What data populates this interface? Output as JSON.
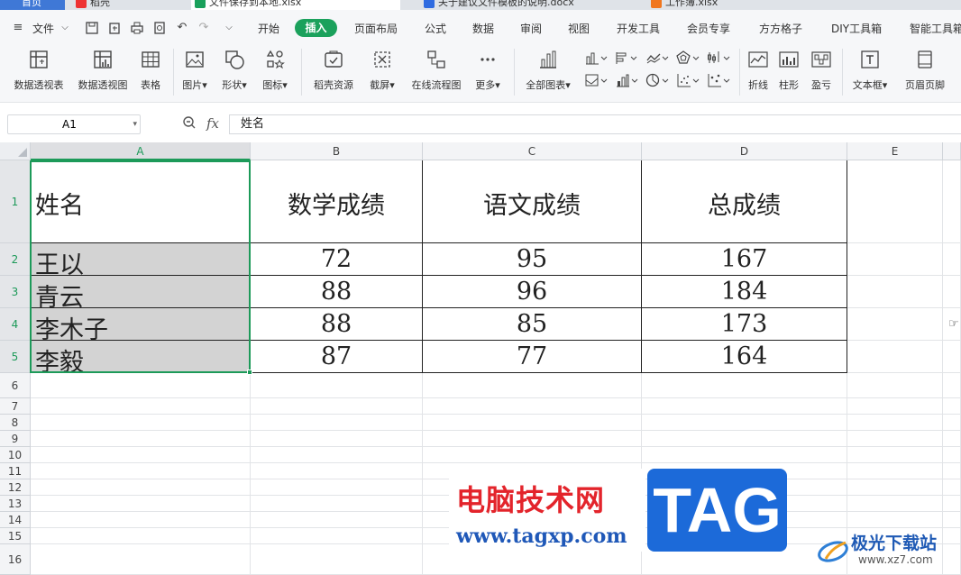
{
  "tabs": [
    {
      "label": "首页",
      "icon": "home-icon"
    },
    {
      "label": "稻壳",
      "icon": "docer-icon"
    },
    {
      "label": "文件保存到本地.xlsx",
      "icon": "spreadsheet-icon"
    },
    {
      "label": "关于建议文件模板的说明.docx",
      "icon": "word-icon"
    },
    {
      "label": "工作簿.xlsx",
      "icon": "pdf-icon"
    }
  ],
  "menu": {
    "file": "文件",
    "items": [
      "开始",
      "插入",
      "页面布局",
      "公式",
      "数据",
      "审阅",
      "视图",
      "开发工具",
      "会员专享",
      "方方格子",
      "DIY工具箱",
      "智能工具箱"
    ],
    "active": "插入"
  },
  "ribbon": {
    "groups": [
      {
        "label": "数据透视表",
        "icon": "pivot-table-icon"
      },
      {
        "label": "数据透视图",
        "icon": "pivot-chart-icon"
      },
      {
        "label": "表格",
        "icon": "table-icon"
      },
      {
        "label": "图片",
        "icon": "image-icon"
      },
      {
        "label": "形状",
        "icon": "shape-icon"
      },
      {
        "label": "图标",
        "icon": "icons-icon"
      },
      {
        "label": "稻壳资源",
        "icon": "resources-icon"
      },
      {
        "label": "截屏",
        "icon": "screenshot-icon"
      },
      {
        "label": "在线流程图",
        "icon": "flowchart-icon"
      },
      {
        "label": "更多",
        "icon": "more-icon"
      },
      {
        "label": "全部图表",
        "icon": "all-charts-icon"
      },
      {
        "label": "折线",
        "icon": "line-chart-icon"
      },
      {
        "label": "柱形",
        "icon": "column-chart-icon"
      },
      {
        "label": "盈亏",
        "icon": "win-loss-icon"
      },
      {
        "label": "文本框",
        "icon": "textbox-icon"
      },
      {
        "label": "页眉页脚",
        "icon": "header-footer-icon"
      }
    ]
  },
  "formula_bar": {
    "name_box": "A1",
    "fx": "fx",
    "content": "姓名"
  },
  "sheet": {
    "columns": [
      "A",
      "B",
      "C",
      "D",
      "E"
    ],
    "selected_column": "A",
    "rows": [
      "1",
      "2",
      "3",
      "4",
      "5",
      "6",
      "7",
      "8",
      "9",
      "10",
      "11",
      "12",
      "13",
      "14",
      "15",
      "16"
    ],
    "selected_rows": [
      "1",
      "2",
      "3",
      "4",
      "5"
    ],
    "headers": [
      "姓名",
      "数学成绩",
      "语文成绩",
      "总成绩"
    ],
    "data": [
      [
        "王以",
        "72",
        "95",
        "167"
      ],
      [
        "青云",
        "88",
        "96",
        "184"
      ],
      [
        "李木子",
        "88",
        "85",
        "173"
      ],
      [
        "李毅",
        "87",
        "77",
        "164"
      ]
    ]
  },
  "watermark": {
    "site_cn": "电脑技术网",
    "site_url": "www.tagxp.com",
    "tag": "TAG",
    "brand": "极光下载站",
    "brand_url": "www.xz7.com"
  }
}
